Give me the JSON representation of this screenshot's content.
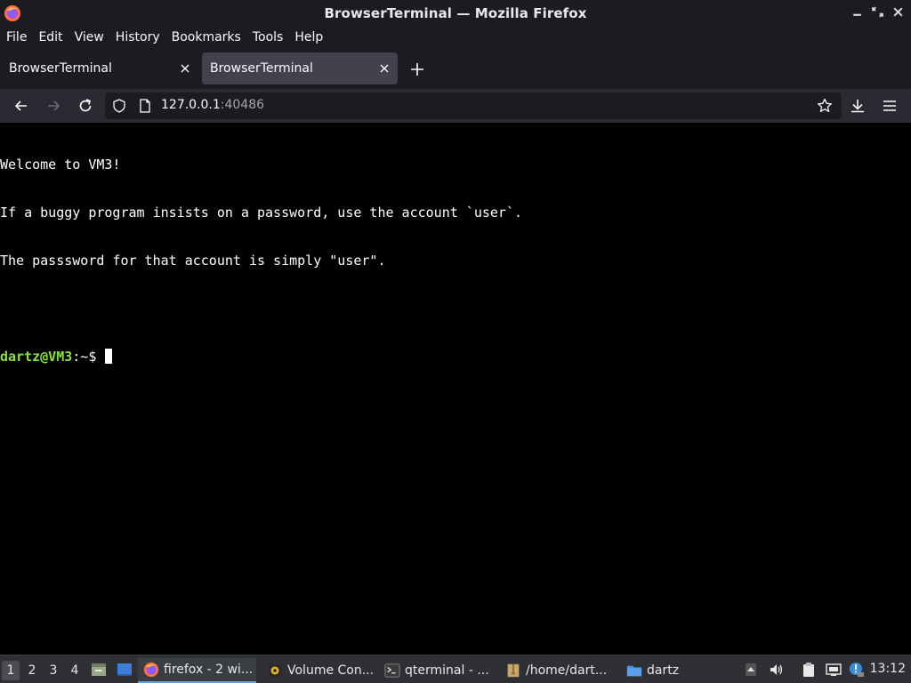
{
  "window": {
    "title": "BrowserTerminal — Mozilla Firefox"
  },
  "menubar": {
    "items": [
      "File",
      "Edit",
      "View",
      "History",
      "Bookmarks",
      "Tools",
      "Help"
    ]
  },
  "tabs": [
    {
      "label": "BrowserTerminal",
      "active": false
    },
    {
      "label": "BrowserTerminal",
      "active": true
    }
  ],
  "urlbar": {
    "host": "127.0.0.1",
    "port": ":40486"
  },
  "terminal": {
    "lines": [
      "Welcome to VM3!",
      "If a buggy program insists on a password, use the account `user`.",
      "The passsword for that account is simply \"user\".",
      ""
    ],
    "prompt_user": "dartz@VM3",
    "prompt_rest": ":~$ ",
    "prompt_user_color": "#8ae234"
  },
  "taskbar": {
    "workspaces": [
      "1",
      "2",
      "3",
      "4"
    ],
    "active_workspace": "1",
    "tasks": [
      {
        "label": "firefox - 2 wi...",
        "icon": "firefox-icon",
        "active": true
      },
      {
        "label": "Volume Con...",
        "icon": "volume-control-icon",
        "active": false
      },
      {
        "label": "qterminal - ...",
        "icon": "terminal-icon",
        "active": false
      },
      {
        "label": "/home/dart...",
        "icon": "archive-icon",
        "active": false
      },
      {
        "label": "dartz",
        "icon": "folder-icon",
        "active": false
      }
    ],
    "clock": "13:12"
  },
  "colors": {
    "titlebar_bg": "#1c1b22",
    "navbar_bg": "#2b2a33",
    "active_tab_bg": "#42414d",
    "taskbar_bg": "#2e3033",
    "terminal_bg": "#000000"
  }
}
